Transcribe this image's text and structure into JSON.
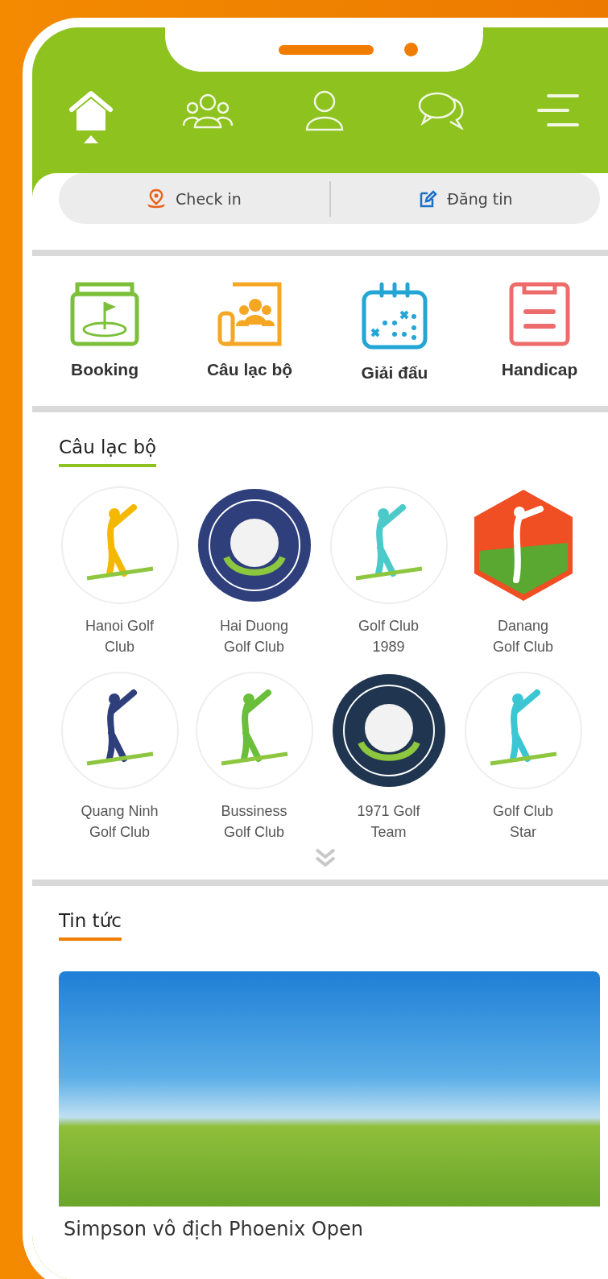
{
  "nav": [
    {
      "kind": "home",
      "selected": true
    },
    {
      "kind": "groups",
      "selected": false
    },
    {
      "kind": "profile",
      "selected": false
    },
    {
      "kind": "chat",
      "selected": false
    },
    {
      "kind": "menu",
      "selected": false
    }
  ],
  "actions": [
    {
      "kind": "checkin",
      "label": "Check in"
    },
    {
      "kind": "post",
      "label": "Đăng tin"
    }
  ],
  "shortcuts": [
    {
      "kind": "booking",
      "label": "Booking",
      "color": "#7cc03a"
    },
    {
      "kind": "clubs",
      "label": "Câu lạc bộ",
      "color": "#f5a623"
    },
    {
      "kind": "tournament",
      "label": "Giải đấu",
      "color": "#23a6d5"
    },
    {
      "kind": "handicap",
      "label": "Handicap",
      "color": "#ee6b6b"
    }
  ],
  "clubs": {
    "title": "Câu lạc bộ",
    "items": [
      {
        "name": "Hanoi Golf\nClub",
        "kind": "plain",
        "color": "#f5b800"
      },
      {
        "name": "Hai Duong\nGolf Club",
        "kind": "badge",
        "color": "#2e3f7c"
      },
      {
        "name": "Golf Club\n1989",
        "kind": "plain",
        "color": "#4cc9c9"
      },
      {
        "name": "Danang\nGolf Club",
        "kind": "hexagon",
        "color": "#f04e23"
      },
      {
        "name": "Quang Ninh\nGolf Club",
        "kind": "plain",
        "color": "#2e3f7c"
      },
      {
        "name": "Bussiness\nGolf Club",
        "kind": "plain",
        "color": "#6abf3a"
      },
      {
        "name": "1971 Golf\nTeam",
        "kind": "badge",
        "color": "#1f3550"
      },
      {
        "name": "Golf Club\nStar",
        "kind": "plain",
        "color": "#3cc6d4"
      }
    ]
  },
  "news": {
    "title": "Tin tức",
    "items": [
      {
        "title": "Simpson vô địch Phoenix Open"
      }
    ]
  }
}
